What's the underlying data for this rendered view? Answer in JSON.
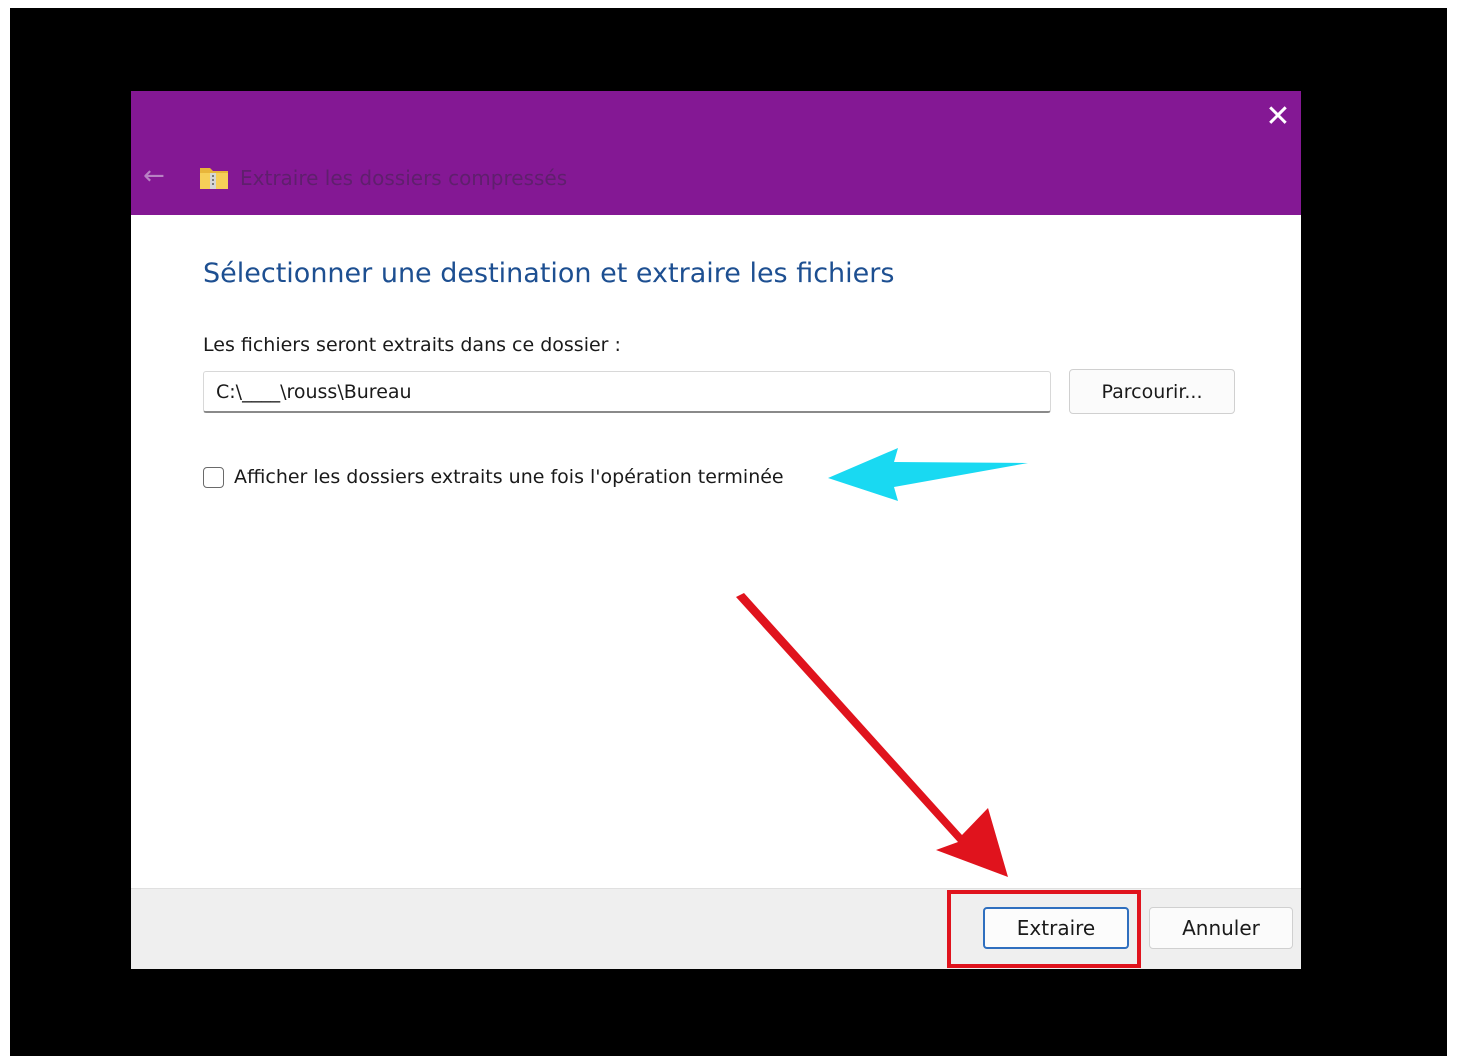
{
  "window": {
    "title": "Extraire les dossiers compressés",
    "close_glyph": "✕",
    "back_glyph": "←",
    "titlebar_color": "#841894"
  },
  "main": {
    "heading": "Sélectionner une destination et extraire les fichiers",
    "destination_label": "Les fichiers seront extraits dans ce dossier :",
    "destination_value": "C:\\____\\rouss\\Bureau",
    "browse_label": "Parcourir...",
    "show_folder_checkbox": {
      "label": "Afficher les dossiers extraits une fois l'opération terminée",
      "checked": false
    }
  },
  "footer": {
    "extract_label": "Extraire",
    "cancel_label": "Annuler"
  },
  "annotations": {
    "cyan_arrow_color": "#19d9f2",
    "red_arrow_color": "#e0131d",
    "highlight_box_color": "#e0131d"
  },
  "icons": [
    "back-arrow-icon",
    "folder-zip-icon",
    "close-icon"
  ]
}
